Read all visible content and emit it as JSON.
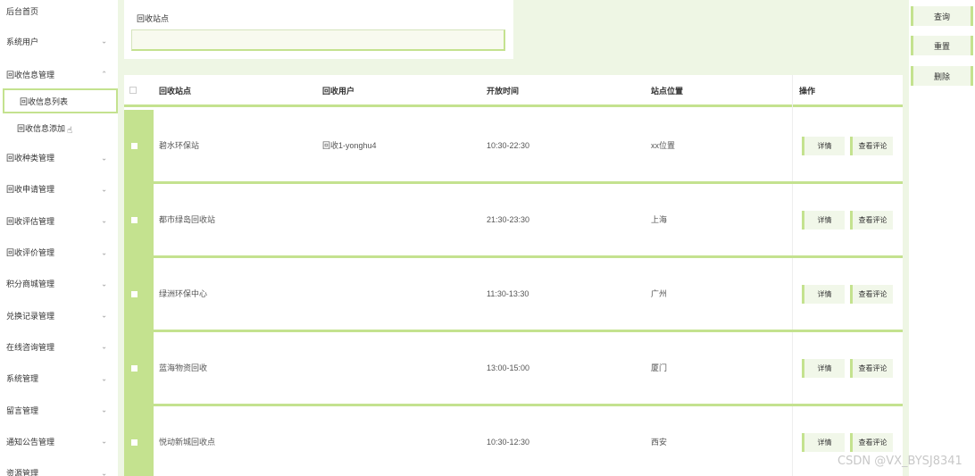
{
  "sidebar": {
    "top": "后台首页",
    "items": [
      {
        "label": "系统用户",
        "chevron": "⌄"
      },
      {
        "label": "回收信息管理",
        "chevron": "⌃"
      },
      {
        "label": "回收种类管理",
        "chevron": "⌄"
      },
      {
        "label": "回收申请管理",
        "chevron": "⌄"
      },
      {
        "label": "回收评估管理",
        "chevron": "⌄"
      },
      {
        "label": "回收评价管理",
        "chevron": "⌄"
      },
      {
        "label": "积分商城管理",
        "chevron": "⌄"
      },
      {
        "label": "兑换记录管理",
        "chevron": "⌄"
      },
      {
        "label": "在线咨询管理",
        "chevron": "⌄"
      },
      {
        "label": "系统管理",
        "chevron": "⌄"
      },
      {
        "label": "留言管理",
        "chevron": "⌄"
      },
      {
        "label": "通知公告管理",
        "chevron": "⌄"
      },
      {
        "label": "资源管理",
        "chevron": "⌄"
      }
    ],
    "sub": {
      "list": "回收信息列表",
      "add": "回收信息添加"
    }
  },
  "search": {
    "label": "回收站点",
    "value": "",
    "placeholder": ""
  },
  "actions": {
    "query": "查询",
    "reset": "重置",
    "delete": "删除"
  },
  "table": {
    "headers": {
      "site": "回收站点",
      "user": "回收用户",
      "time": "开放时间",
      "location": "站点位置",
      "ops": "操作"
    },
    "rows": [
      {
        "site": "碧水环保站",
        "user": "回收1-yonghu4",
        "time": "10:30-22:30",
        "location": "xx位置"
      },
      {
        "site": "都市绿岛回收站",
        "user": "",
        "time": "21:30-23:30",
        "location": "上海"
      },
      {
        "site": "绿洲环保中心",
        "user": "",
        "time": "11:30-13:30",
        "location": "广州"
      },
      {
        "site": "蓝海物资回收",
        "user": "",
        "time": "13:00-15:00",
        "location": "厦门"
      },
      {
        "site": "悦动新城回收点",
        "user": "",
        "time": "10:30-12:30",
        "location": "西安"
      }
    ],
    "op_detail": "详情",
    "op_review": "查看评论"
  },
  "watermark": "CSDN @VX_BYSJ8341",
  "colors": {
    "accent": "#c4e28f",
    "page_bg": "#eef6e4"
  }
}
